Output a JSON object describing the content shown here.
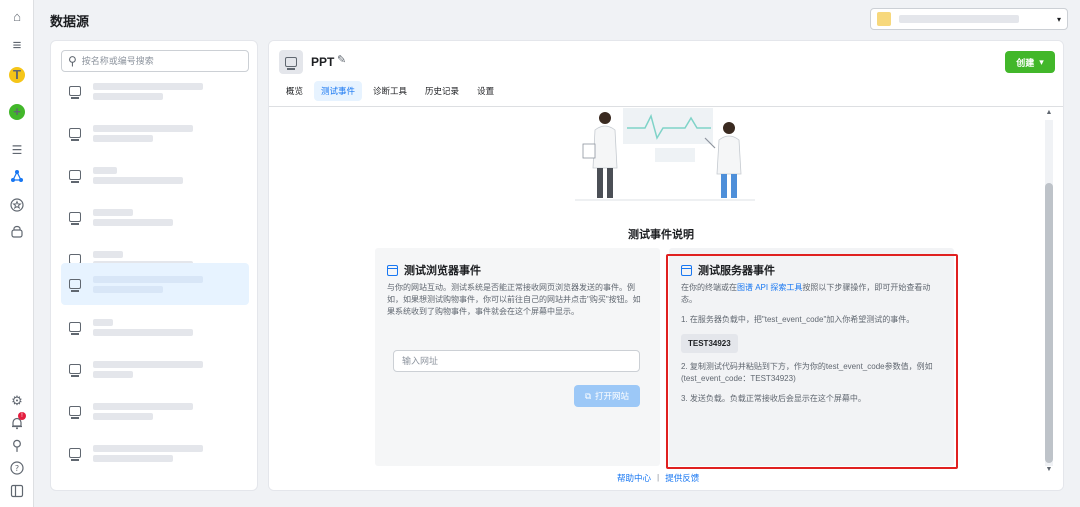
{
  "app": {
    "page_title": "数据源"
  },
  "rail": {
    "avatar_letter": "T",
    "create_plus": "+"
  },
  "account_selector": {
    "caret": "▾"
  },
  "search": {
    "placeholder": "按名称或编号搜索",
    "value": ""
  },
  "datasource_list": {
    "item_count": 10,
    "active_index": 4
  },
  "pixel": {
    "name": "PPT"
  },
  "create_button": {
    "label": "创建",
    "caret": "▾"
  },
  "tabs": [
    {
      "label": "概览",
      "active": false
    },
    {
      "label": "测试事件",
      "active": true
    },
    {
      "label": "诊断工具",
      "active": false
    },
    {
      "label": "历史记录",
      "active": false
    },
    {
      "label": "设置",
      "active": false
    }
  ],
  "explanation": {
    "title": "测试事件说明"
  },
  "browser_card": {
    "title": "测试浏览器事件",
    "description": "与你的网站互动。测试系统是否能正常接收网页浏览器发送的事件。例如，如果想测试购物事件，你可以前往自己的网站并点击\"购买\"按钮。如果系统收到了购物事件，事件就会在这个屏幕中显示。",
    "url_placeholder": "输入网址",
    "open_button": "打开网站"
  },
  "server_card": {
    "title": "测试服务器事件",
    "intro_before_link": "在你的终端或在",
    "intro_link": "图谱 API 探索工具",
    "intro_after_link": "按照以下步骤操作，即可开始查看动态。",
    "step1": "1. 在服务器负载中，把\"test_event_code\"加入你希望测试的事件。",
    "code": "TEST34923",
    "step2": "2. 复制测试代码并粘贴到下方，作为你的test_event_code参数值，例如(test_event_code：TEST34923)",
    "step3": "3. 发送负载。负载正常接收后会显示在这个屏幕中。"
  },
  "footer": {
    "help": "帮助中心",
    "separator": "|",
    "feedback": "提供反馈"
  },
  "colors": {
    "accent": "#1877f2",
    "create_green": "#42b72a",
    "highlight_red": "#e02020",
    "active_bg": "#e7f3ff"
  }
}
